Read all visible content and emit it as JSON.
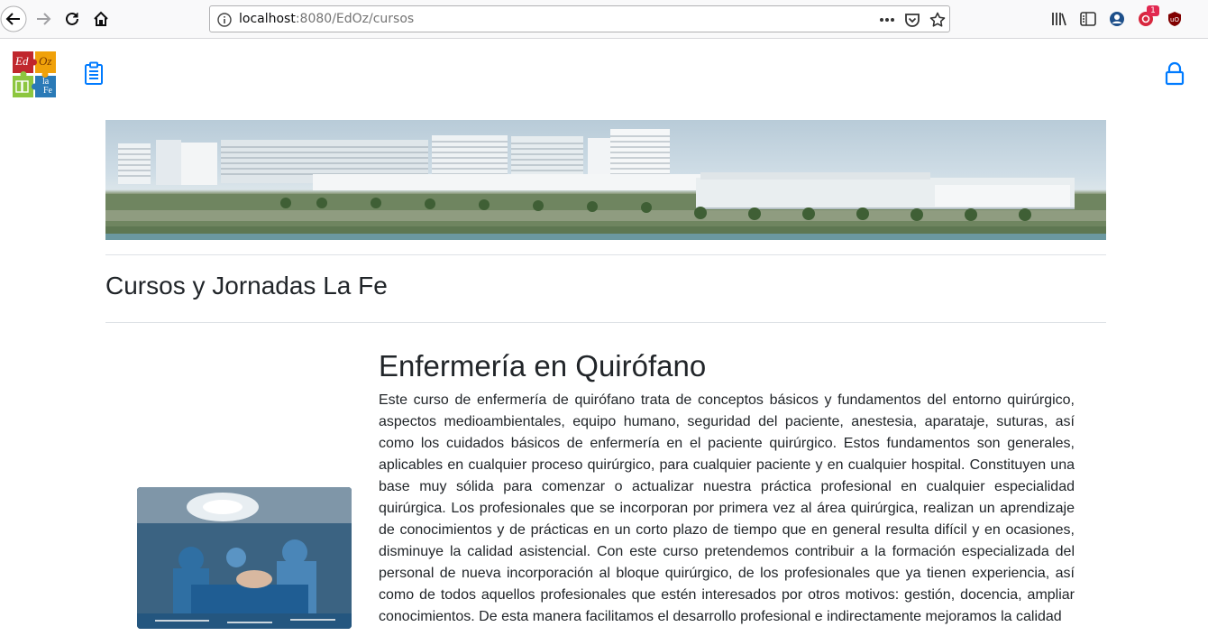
{
  "browser": {
    "url_host": "localhost",
    "url_rest": ":8080/EdOz/cursos",
    "notification_count": "1",
    "icons": [
      "back-icon",
      "forward-icon",
      "reload-icon",
      "home-icon",
      "info-icon",
      "page-actions-icon",
      "pocket-icon",
      "bookmark-star-icon",
      "library-icon",
      "sidebar-icon",
      "account-icon",
      "extension-icon",
      "ublock-icon"
    ]
  },
  "navbar": {
    "logo_letters": [
      "Ed",
      "Oz",
      "la",
      "Fe"
    ],
    "icons": [
      "clipboard-icon",
      "lock-icon"
    ]
  },
  "page": {
    "title": "Cursos y Jornadas La Fe"
  },
  "course": {
    "title": "Enfermería en Quirófano",
    "description": "Este curso de enfermería de quirófano trata de conceptos básicos y fundamentos del entorno quirúrgico, aspectos medioambientales, equipo humano, seguridad del paciente, anestesia, aparataje, suturas, así como los cuidados básicos de enfermería en el paciente quirúrgico. Estos fundamentos son generales, aplicables en cualquier proceso quirúrgico, para cualquier paciente y en cualquier hospital. Constituyen una base muy sólida para comenzar o actualizar nuestra práctica profesional en cualquier especialidad quirúrgica. Los profesionales que se incorporan por primera vez al área quirúrgica, realizan un aprendizaje de conocimientos y de prácticas en un corto plazo de tiempo que en general resulta difícil y en ocasiones, disminuye la calidad asistencial. Con este curso pretendemos contribuir a la formación especializada del personal de nueva incorporación al bloque quirúrgico, de los profesionales que ya tienen experiencia, así como de todos aquellos profesionales que estén interesados por otros motivos: gestión, docencia, ampliar conocimientos. De esta manera facilitamos el desarrollo profesional e indirectamente mejoramos la calidad"
  },
  "colors": {
    "accent": "#007bff",
    "text": "#212529",
    "rule": "#dee2e6"
  }
}
